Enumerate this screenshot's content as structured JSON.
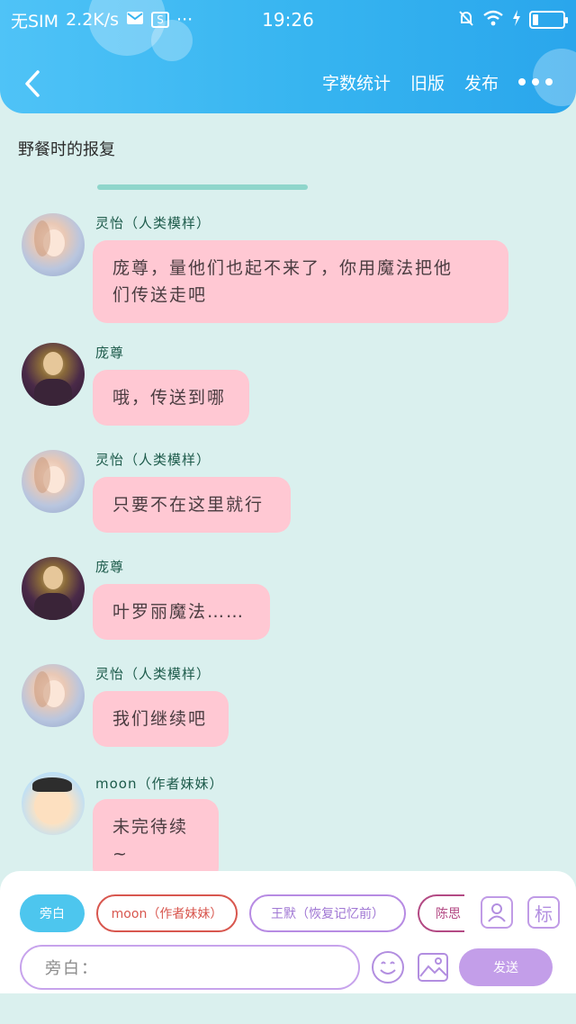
{
  "status_bar": {
    "carrier": "无SIM",
    "speed": "2.2K/s",
    "more": "···",
    "time": "19:26"
  },
  "nav": {
    "word_count": "字数统计",
    "old_version": "旧版",
    "publish": "发布"
  },
  "doc_title": "野餐时的报复",
  "messages": [
    {
      "speaker": "灵怡（人类模样）",
      "text_lines": [
        "庞尊，量他们也起不来了，你用魔法把他",
        "们传送走吧"
      ]
    },
    {
      "speaker": "庞尊",
      "text_lines": [
        "哦，传送到哪"
      ]
    },
    {
      "speaker": "灵怡（人类模样）",
      "text_lines": [
        "只要不在这里就行"
      ]
    },
    {
      "speaker": "庞尊",
      "text_lines": [
        "叶罗丽魔法……"
      ]
    },
    {
      "speaker": "灵怡（人类模样）",
      "text_lines": [
        "我们继续吧"
      ]
    },
    {
      "speaker": "moon（作者妹妹）",
      "text_lines": [
        "未完待续~"
      ]
    }
  ],
  "composer": {
    "chips": [
      "旁白",
      "moon（作者妹妹）",
      "王默（恢复记忆前）",
      "陈思"
    ],
    "role_icon_label": "标",
    "input_placeholder": "旁白：",
    "send_label": "发送"
  },
  "colors": {
    "header": "#36b4f0",
    "background": "#daf0ee",
    "bubble": "#ffc8d3",
    "active_chip": "#4dc6ee",
    "send_button": "#c39ee9"
  }
}
